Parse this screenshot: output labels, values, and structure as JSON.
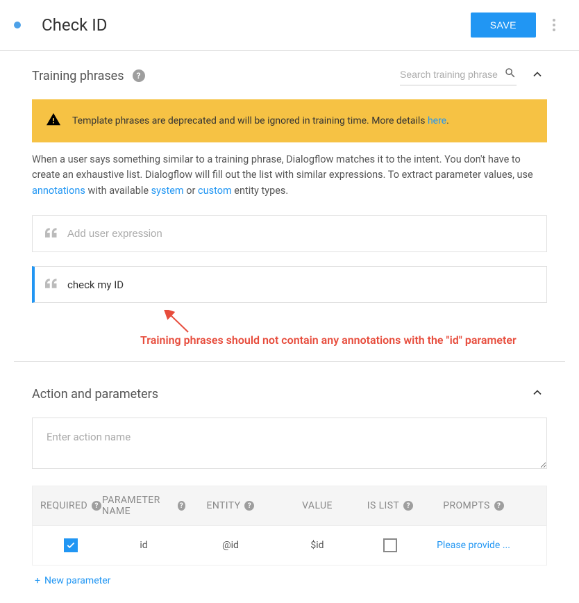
{
  "header": {
    "title": "Check ID",
    "save_label": "SAVE"
  },
  "training": {
    "section_title": "Training phrases",
    "search_placeholder": "Search training phrase",
    "warning": "Template phrases are deprecated and will be ignored in training time. More details ",
    "warning_link": "here",
    "warning_period": ".",
    "desc_1": "When a user says something similar to a training phrase, Dialogflow matches it to the intent. You don't have to create an exhaustive list. Dialogflow will fill out the list with similar expressions. To extract parameter values, use ",
    "desc_link1": "annotations",
    "desc_2": " with available ",
    "desc_link2": "system",
    "desc_3": " or ",
    "desc_link3": "custom",
    "desc_4": " entity types.",
    "add_placeholder": "Add user expression",
    "phrase_1": "check my ID",
    "annotation_note": "Training phrases should not contain any annotations with the \"id\" parameter"
  },
  "action": {
    "section_title": "Action and parameters",
    "action_placeholder": "Enter action name",
    "headers": {
      "required": "REQUIRED",
      "name": "PARAMETER NAME",
      "entity": "ENTITY",
      "value": "VALUE",
      "list": "IS LIST",
      "prompts": "PROMPTS"
    },
    "row": {
      "name": "id",
      "entity": "@id",
      "value": "$id",
      "prompt": "Please provide ..."
    },
    "new_param": "New parameter"
  }
}
